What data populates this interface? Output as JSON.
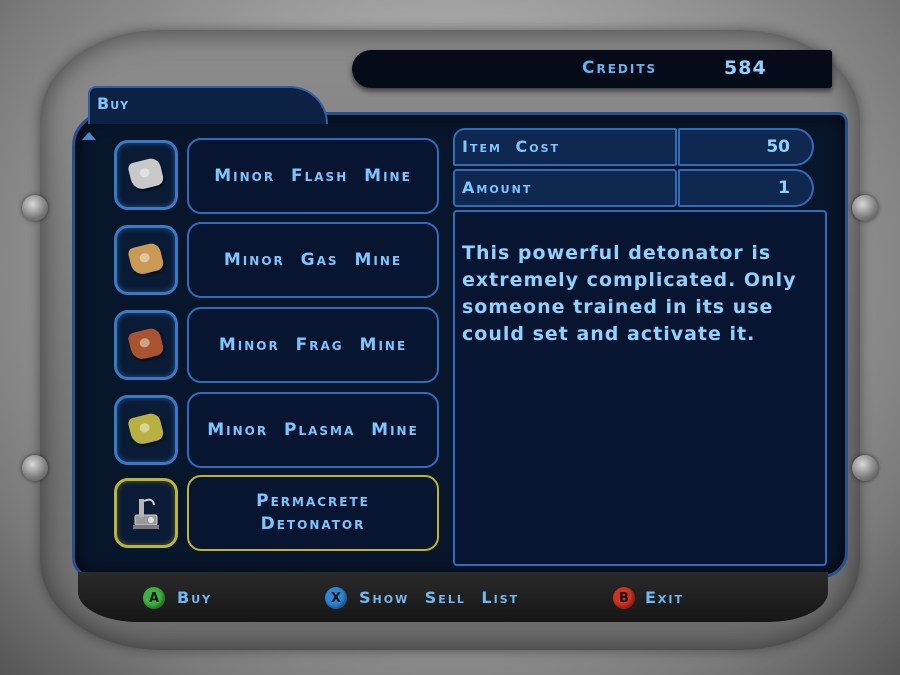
{
  "credits": {
    "label": "Credits",
    "value": "584"
  },
  "tab": {
    "label": "Buy"
  },
  "items": [
    {
      "name": "Minor Flash Mine",
      "icon": "flash-mine-icon",
      "color": "#c8c8c8"
    },
    {
      "name": "Minor Gas Mine",
      "icon": "gas-mine-icon",
      "color": "#c99a55"
    },
    {
      "name": "Minor Frag Mine",
      "icon": "frag-mine-icon",
      "color": "#a8552f"
    },
    {
      "name": "Minor Plasma Mine",
      "icon": "plasma-mine-icon",
      "color": "#b8b040"
    },
    {
      "name": "Permacrete Detonator",
      "icon": "detonator-icon",
      "color": "#b0b0b0",
      "selected": true
    }
  ],
  "details": {
    "item_cost_label": "Item Cost",
    "item_cost_value": "50",
    "amount_label": "Amount",
    "amount_value": "1",
    "description": "This powerful detonator is extremely complicated. Only someone trained in its use could set and activate it."
  },
  "controls": [
    {
      "button": "A",
      "label": "Buy",
      "color": "#3db33d"
    },
    {
      "button": "X",
      "label": "Show Sell List",
      "color": "#2e86d6"
    },
    {
      "button": "B",
      "label": "Exit",
      "color": "#d0331f"
    }
  ]
}
